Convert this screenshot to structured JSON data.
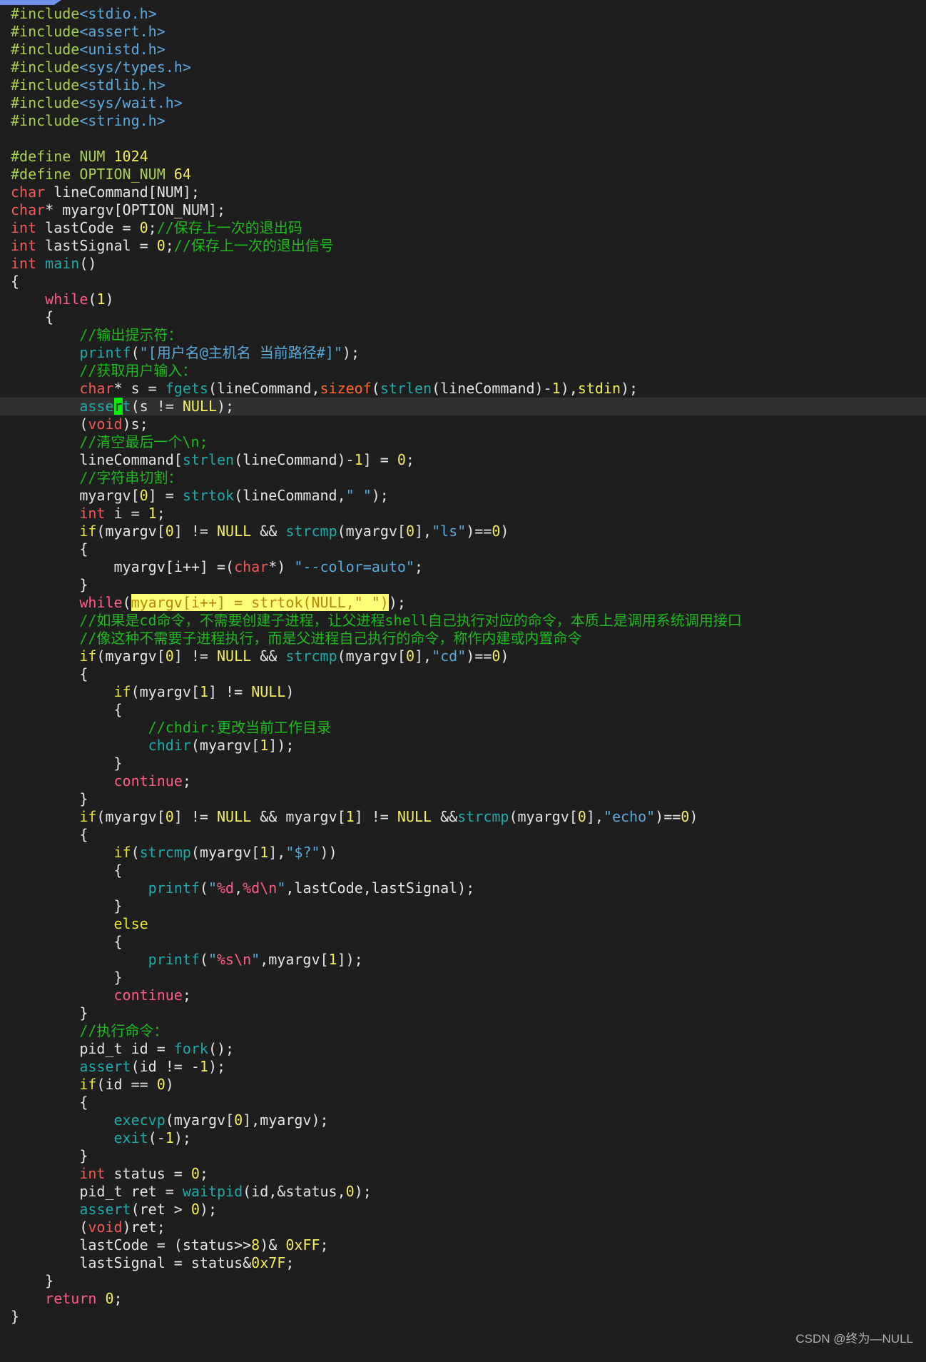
{
  "editor": {
    "current_line": 23,
    "watermark": "CSDN @终为—NULL"
  },
  "lines": [
    [
      [
        "p",
        "#include"
      ],
      [
        "h",
        "<stdio.h>"
      ]
    ],
    [
      [
        "p",
        "#include"
      ],
      [
        "h",
        "<assert.h>"
      ]
    ],
    [
      [
        "p",
        "#include"
      ],
      [
        "h",
        "<unistd.h>"
      ]
    ],
    [
      [
        "p",
        "#include"
      ],
      [
        "h",
        "<sys/types.h>"
      ]
    ],
    [
      [
        "p",
        "#include"
      ],
      [
        "h",
        "<stdlib.h>"
      ]
    ],
    [
      [
        "p",
        "#include"
      ],
      [
        "h",
        "<sys/wait.h>"
      ]
    ],
    [
      [
        "p",
        "#include"
      ],
      [
        "h",
        "<string.h>"
      ]
    ],
    [],
    [
      [
        "p",
        "#define NUM "
      ],
      [
        "n",
        "1024"
      ]
    ],
    [
      [
        "p",
        "#define OPTION_NUM "
      ],
      [
        "n",
        "64"
      ]
    ],
    [
      [
        "k",
        "char"
      ],
      [
        "t",
        " lineCommand[NUM];"
      ]
    ],
    [
      [
        "k",
        "char"
      ],
      [
        "t",
        "* myargv[OPTION_NUM];"
      ]
    ],
    [
      [
        "k",
        "int"
      ],
      [
        "t",
        " lastCode = "
      ],
      [
        "n",
        "0"
      ],
      [
        "t",
        ";"
      ],
      [
        "c",
        "//保存上一次的退出码"
      ]
    ],
    [
      [
        "k",
        "int"
      ],
      [
        "t",
        " lastSignal = "
      ],
      [
        "n",
        "0"
      ],
      [
        "t",
        ";"
      ],
      [
        "c",
        "//保存上一次的退出信号"
      ]
    ],
    [
      [
        "k",
        "int"
      ],
      [
        "t",
        " "
      ],
      [
        "f",
        "main"
      ],
      [
        "t",
        "()"
      ]
    ],
    [
      [
        "t",
        "{"
      ]
    ],
    [
      [
        "t",
        "    "
      ],
      [
        "w",
        "while"
      ],
      [
        "t",
        "("
      ],
      [
        "n",
        "1"
      ],
      [
        "t",
        ")"
      ]
    ],
    [
      [
        "t",
        "    {"
      ]
    ],
    [
      [
        "t",
        "        "
      ],
      [
        "c",
        "//输出提示符："
      ]
    ],
    [
      [
        "t",
        "        "
      ],
      [
        "f",
        "printf"
      ],
      [
        "t",
        "("
      ],
      [
        "s",
        "\"[用户名@主机名 当前路径#]\""
      ],
      [
        "t",
        ");"
      ]
    ],
    [
      [
        "t",
        "        "
      ],
      [
        "c",
        "//获取用户输入："
      ]
    ],
    [
      [
        "t",
        "        "
      ],
      [
        "k",
        "char"
      ],
      [
        "t",
        "* s = "
      ],
      [
        "f",
        "fgets"
      ],
      [
        "t",
        "(lineCommand,"
      ],
      [
        "o",
        "sizeof"
      ],
      [
        "t",
        "("
      ],
      [
        "f",
        "strlen"
      ],
      [
        "t",
        "(lineCommand)-"
      ],
      [
        "n",
        "1"
      ],
      [
        "t",
        "),"
      ],
      [
        "n",
        "stdin"
      ],
      [
        "t",
        ");"
      ]
    ],
    [
      [
        "t",
        "        "
      ],
      [
        "f",
        "asse"
      ],
      [
        "cur-ch",
        "r"
      ],
      [
        "f",
        "t"
      ],
      [
        "t",
        "(s != "
      ],
      [
        "n",
        "NULL"
      ],
      [
        "t",
        ");"
      ]
    ],
    [
      [
        "t",
        "        ("
      ],
      [
        "k",
        "void"
      ],
      [
        "t",
        ")s;"
      ]
    ],
    [
      [
        "t",
        "        "
      ],
      [
        "c",
        "//清空最后一个\\n;"
      ]
    ],
    [
      [
        "t",
        "        lineCommand["
      ],
      [
        "f",
        "strlen"
      ],
      [
        "t",
        "(lineCommand)-"
      ],
      [
        "n",
        "1"
      ],
      [
        "t",
        "] = "
      ],
      [
        "n",
        "0"
      ],
      [
        "t",
        ";"
      ]
    ],
    [
      [
        "t",
        "        "
      ],
      [
        "c",
        "//字符串切割："
      ]
    ],
    [
      [
        "t",
        "        myargv["
      ],
      [
        "n",
        "0"
      ],
      [
        "t",
        "] = "
      ],
      [
        "f",
        "strtok"
      ],
      [
        "t",
        "(lineCommand,"
      ],
      [
        "s",
        "\" \""
      ],
      [
        "t",
        ");"
      ]
    ],
    [
      [
        "t",
        "        "
      ],
      [
        "k",
        "int"
      ],
      [
        "t",
        " i = "
      ],
      [
        "n",
        "1"
      ],
      [
        "t",
        ";"
      ]
    ],
    [
      [
        "t",
        "        "
      ],
      [
        "y",
        "if"
      ],
      [
        "t",
        "(myargv["
      ],
      [
        "n",
        "0"
      ],
      [
        "t",
        "] != "
      ],
      [
        "n",
        "NULL"
      ],
      [
        "t",
        " && "
      ],
      [
        "f",
        "strcmp"
      ],
      [
        "t",
        "(myargv["
      ],
      [
        "n",
        "0"
      ],
      [
        "t",
        "],"
      ],
      [
        "s",
        "\"ls\""
      ],
      [
        "t",
        ")=="
      ],
      [
        "n",
        "0"
      ],
      [
        "t",
        ")"
      ]
    ],
    [
      [
        "t",
        "        {"
      ]
    ],
    [
      [
        "t",
        "            myargv[i++] =("
      ],
      [
        "k",
        "char"
      ],
      [
        "t",
        "*) "
      ],
      [
        "s",
        "\"--color=auto\""
      ],
      [
        "t",
        ";"
      ]
    ],
    [
      [
        "t",
        "        }"
      ]
    ],
    [
      [
        "t",
        "        "
      ],
      [
        "w",
        "while"
      ],
      [
        "t",
        "("
      ],
      [
        "m",
        "myargv[i++] = strtok(NULL,\" \")"
      ],
      [
        "t",
        ");"
      ]
    ],
    [
      [
        "t",
        "        "
      ],
      [
        "c",
        "//如果是cd命令，不需要创建子进程，让父进程shell自己执行对应的命令，本质上是调用系统调用接口"
      ]
    ],
    [
      [
        "t",
        "        "
      ],
      [
        "c",
        "//像这种不需要子进程执行，而是父进程自己执行的命令，称作内建或内置命令"
      ]
    ],
    [
      [
        "t",
        "        "
      ],
      [
        "y",
        "if"
      ],
      [
        "t",
        "(myargv["
      ],
      [
        "n",
        "0"
      ],
      [
        "t",
        "] != "
      ],
      [
        "n",
        "NULL"
      ],
      [
        "t",
        " && "
      ],
      [
        "f",
        "strcmp"
      ],
      [
        "t",
        "(myargv["
      ],
      [
        "n",
        "0"
      ],
      [
        "t",
        "],"
      ],
      [
        "s",
        "\"cd\""
      ],
      [
        "t",
        ")=="
      ],
      [
        "n",
        "0"
      ],
      [
        "t",
        ")"
      ]
    ],
    [
      [
        "t",
        "        {"
      ]
    ],
    [
      [
        "t",
        "            "
      ],
      [
        "y",
        "if"
      ],
      [
        "t",
        "(myargv["
      ],
      [
        "n",
        "1"
      ],
      [
        "t",
        "] != "
      ],
      [
        "n",
        "NULL"
      ],
      [
        "t",
        ")"
      ]
    ],
    [
      [
        "t",
        "            {"
      ]
    ],
    [
      [
        "t",
        "                "
      ],
      [
        "c",
        "//chdir:更改当前工作目录"
      ]
    ],
    [
      [
        "t",
        "                "
      ],
      [
        "f",
        "chdir"
      ],
      [
        "t",
        "(myargv["
      ],
      [
        "n",
        "1"
      ],
      [
        "t",
        "]);"
      ]
    ],
    [
      [
        "t",
        "            }"
      ]
    ],
    [
      [
        "t",
        "            "
      ],
      [
        "w",
        "continue"
      ],
      [
        "t",
        ";"
      ]
    ],
    [
      [
        "t",
        "        }"
      ]
    ],
    [
      [
        "t",
        "        "
      ],
      [
        "y",
        "if"
      ],
      [
        "t",
        "(myargv["
      ],
      [
        "n",
        "0"
      ],
      [
        "t",
        "] != "
      ],
      [
        "n",
        "NULL"
      ],
      [
        "t",
        " && myargv["
      ],
      [
        "n",
        "1"
      ],
      [
        "t",
        "] != "
      ],
      [
        "n",
        "NULL"
      ],
      [
        "t",
        " &&"
      ],
      [
        "f",
        "strcmp"
      ],
      [
        "t",
        "(myargv["
      ],
      [
        "n",
        "0"
      ],
      [
        "t",
        "],"
      ],
      [
        "s",
        "\"echo\""
      ],
      [
        "t",
        ")=="
      ],
      [
        "n",
        "0"
      ],
      [
        "t",
        ")"
      ]
    ],
    [
      [
        "t",
        "        {"
      ]
    ],
    [
      [
        "t",
        "            "
      ],
      [
        "y",
        "if"
      ],
      [
        "t",
        "("
      ],
      [
        "f",
        "strcmp"
      ],
      [
        "t",
        "(myargv["
      ],
      [
        "n",
        "1"
      ],
      [
        "t",
        "],"
      ],
      [
        "s",
        "\"$?\""
      ],
      [
        "t",
        "))"
      ]
    ],
    [
      [
        "t",
        "            {"
      ]
    ],
    [
      [
        "t",
        "                "
      ],
      [
        "f",
        "printf"
      ],
      [
        "t",
        "("
      ],
      [
        "s",
        "\""
      ],
      [
        "e",
        "%d"
      ],
      [
        "t",
        ","
      ],
      [
        "e",
        "%d\\n"
      ],
      [
        "s",
        "\""
      ],
      [
        "t",
        ",lastCode,lastSignal);"
      ]
    ],
    [
      [
        "t",
        "            }"
      ]
    ],
    [
      [
        "t",
        "            "
      ],
      [
        "y",
        "else"
      ]
    ],
    [
      [
        "t",
        "            {"
      ]
    ],
    [
      [
        "t",
        "                "
      ],
      [
        "f",
        "printf"
      ],
      [
        "t",
        "("
      ],
      [
        "s",
        "\""
      ],
      [
        "e",
        "%s\\n"
      ],
      [
        "s",
        "\""
      ],
      [
        "t",
        ",myargv["
      ],
      [
        "n",
        "1"
      ],
      [
        "t",
        "]);"
      ]
    ],
    [
      [
        "t",
        "            }"
      ]
    ],
    [
      [
        "t",
        "            "
      ],
      [
        "w",
        "continue"
      ],
      [
        "t",
        ";"
      ]
    ],
    [
      [
        "t",
        "        }"
      ]
    ],
    [
      [
        "t",
        "        "
      ],
      [
        "c",
        "//执行命令："
      ]
    ],
    [
      [
        "t",
        "        pid_t id = "
      ],
      [
        "f",
        "fork"
      ],
      [
        "t",
        "();"
      ]
    ],
    [
      [
        "t",
        "        "
      ],
      [
        "f",
        "assert"
      ],
      [
        "t",
        "(id != -"
      ],
      [
        "n",
        "1"
      ],
      [
        "t",
        ");"
      ]
    ],
    [
      [
        "t",
        "        "
      ],
      [
        "y",
        "if"
      ],
      [
        "t",
        "(id == "
      ],
      [
        "n",
        "0"
      ],
      [
        "t",
        ")"
      ]
    ],
    [
      [
        "t",
        "        {"
      ]
    ],
    [
      [
        "t",
        "            "
      ],
      [
        "f",
        "execvp"
      ],
      [
        "t",
        "(myargv["
      ],
      [
        "n",
        "0"
      ],
      [
        "t",
        "],myargv);"
      ]
    ],
    [
      [
        "t",
        "            "
      ],
      [
        "f",
        "exit"
      ],
      [
        "t",
        "(-"
      ],
      [
        "n",
        "1"
      ],
      [
        "t",
        ");"
      ]
    ],
    [
      [
        "t",
        "        }"
      ]
    ],
    [
      [
        "t",
        "        "
      ],
      [
        "k",
        "int"
      ],
      [
        "t",
        " status = "
      ],
      [
        "n",
        "0"
      ],
      [
        "t",
        ";"
      ]
    ],
    [
      [
        "t",
        "        pid_t ret = "
      ],
      [
        "f",
        "waitpid"
      ],
      [
        "t",
        "(id,&status,"
      ],
      [
        "n",
        "0"
      ],
      [
        "t",
        ");"
      ]
    ],
    [
      [
        "t",
        "        "
      ],
      [
        "f",
        "assert"
      ],
      [
        "t",
        "(ret > "
      ],
      [
        "n",
        "0"
      ],
      [
        "t",
        ");"
      ]
    ],
    [
      [
        "t",
        "        ("
      ],
      [
        "k",
        "void"
      ],
      [
        "t",
        ")ret;"
      ]
    ],
    [
      [
        "t",
        "        lastCode = (status>>"
      ],
      [
        "n",
        "8"
      ],
      [
        "t",
        ")& "
      ],
      [
        "n",
        "0xFF"
      ],
      [
        "t",
        ";"
      ]
    ],
    [
      [
        "t",
        "        lastSignal = status&"
      ],
      [
        "n",
        "0x7F"
      ],
      [
        "t",
        ";"
      ]
    ],
    [
      [
        "t",
        "    }"
      ]
    ],
    [
      [
        "t",
        "    "
      ],
      [
        "w",
        "return"
      ],
      [
        "t",
        " "
      ],
      [
        "n",
        "0"
      ],
      [
        "t",
        ";"
      ]
    ],
    [
      [
        "t",
        "}"
      ]
    ]
  ]
}
